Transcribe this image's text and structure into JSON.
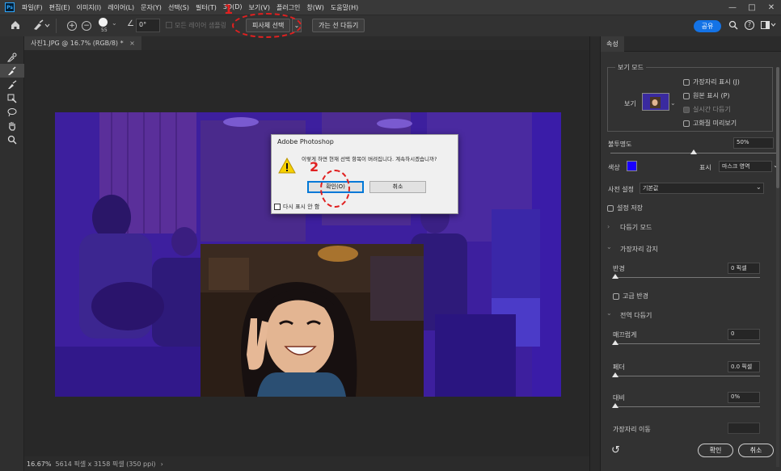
{
  "menubar": {
    "logo": "Ps",
    "items": [
      "파일(F)",
      "편집(E)",
      "이미지(I)",
      "레이어(L)",
      "문자(Y)",
      "선택(S)",
      "필터(T)",
      "3D(D)",
      "보기(V)",
      "플러그인",
      "창(W)",
      "도움말(H)"
    ],
    "minimize": "—",
    "maximize": "□",
    "close": "✕"
  },
  "options": {
    "brush_size": "55",
    "angle_value": "0°",
    "sample_all_layers": "모든 레이어 샘플링",
    "select_subject": "피사체 선택",
    "refine_hair": "가는 선 다듬기",
    "share": "공유",
    "help": "?"
  },
  "annotations": {
    "step1": "1",
    "step2": "2"
  },
  "document": {
    "tab_title": "사진1.JPG @ 16.7% (RGB/8) *",
    "tab_close": "×",
    "zoom": "16.67%",
    "doc_info": "5614 픽셀 x 3158 픽셀 (350 ppi)",
    "status_arrow": "›"
  },
  "dialog": {
    "title": "Adobe Photoshop",
    "message": "이렇게 하면 현재 선택 항목이 버려집니다. 계속하시겠습니까?",
    "ok": "확인(O)",
    "cancel": "취소",
    "dont_show": "다시 표시 안 함"
  },
  "panel": {
    "tab": "속성",
    "view_mode_section": "보기 모드",
    "view_label": "보기",
    "show_edges": "가장자리 표시 (J)",
    "show_original": "원본 표시 (P)",
    "realtime_refine": "실시간 다듬기",
    "hq_preview": "고화질 미리보기",
    "opacity_label": "불투명도",
    "opacity_value": "50%",
    "opacity_fraction": 0.5,
    "color_label": "색상",
    "color_value": "#1a00ff",
    "show_label": "표시",
    "show_value": "마스크 영역",
    "preset_label": "사전 설정",
    "preset_value": "기본값",
    "save_settings": "설정 저장",
    "refine_mode": "다듬기 모드",
    "edge_detection": "가장자리 감지",
    "radius_label": "반경",
    "radius_value": "0 픽셀",
    "smart_radius": "고급 반경",
    "global_refine": "전역 다듬기",
    "smooth_label": "매끄럽게",
    "smooth_value": "0",
    "feather_label": "페더",
    "feather_value": "0.0 픽셀",
    "contrast_label": "대비",
    "contrast_value": "0%",
    "shift_edge_label": "가장자리 이동",
    "ok": "확인",
    "cancel": "취소",
    "reset_icon": "↺"
  }
}
